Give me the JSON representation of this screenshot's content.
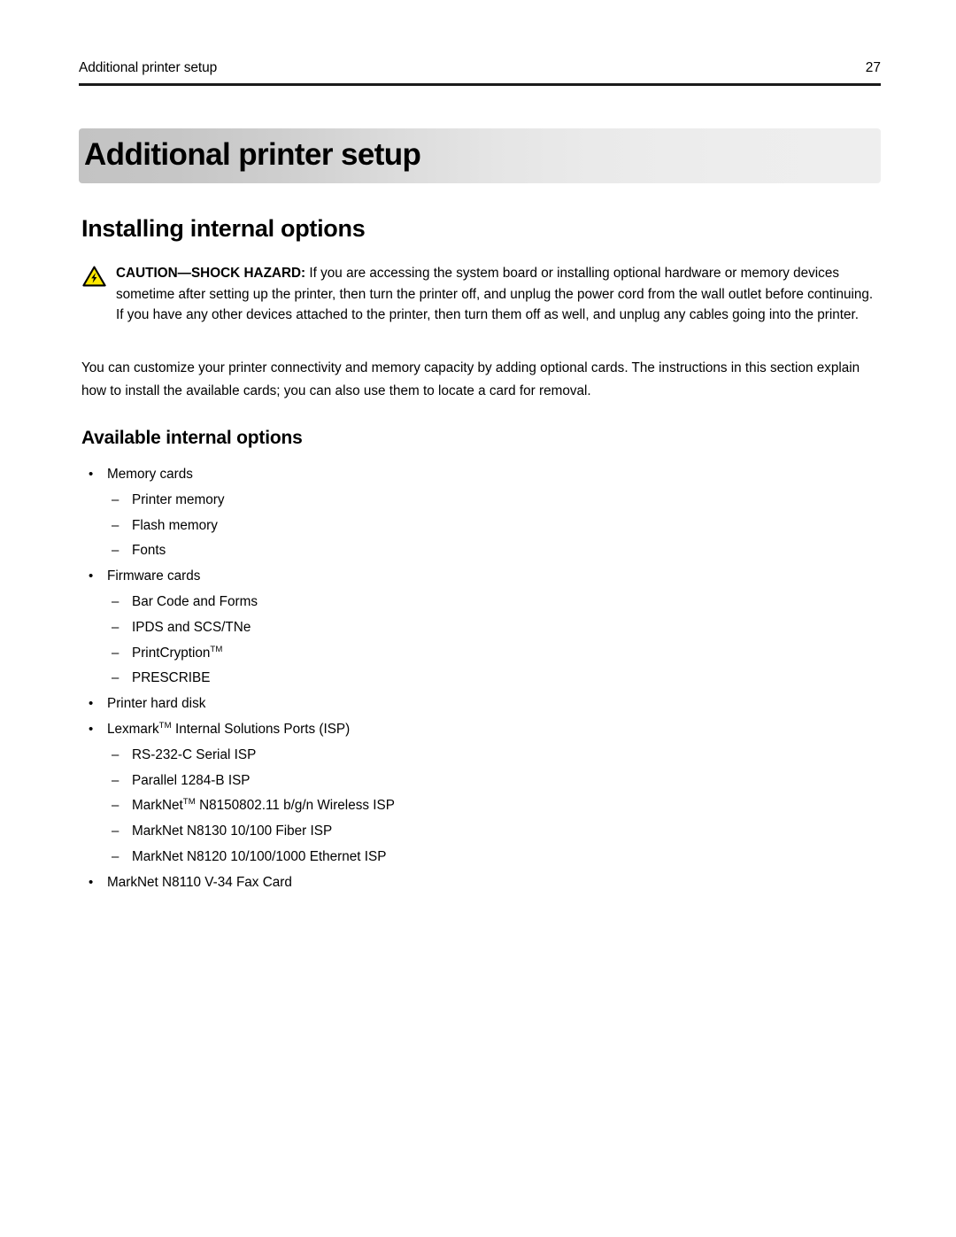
{
  "header": {
    "title": "Additional printer setup",
    "page_number": "27"
  },
  "chapter": {
    "title": "Additional printer setup"
  },
  "sections": {
    "h1": "Installing internal options",
    "h2": "Available internal options"
  },
  "caution": {
    "icon": "shock-hazard-warning-icon",
    "label": "CAUTION—SHOCK HAZARD:",
    "text": " If you are accessing the system board or installing optional hardware or memory devices sometime after setting up the printer, then turn the printer off, and unplug the power cord from the wall outlet before continuing. If you have any other devices attached to the printer, then turn them off as well, and unplug any cables going into the printer.",
    "icon_colors": {
      "fill": "#ffe800",
      "stroke": "#000000"
    }
  },
  "body_paragraph": "You can customize your printer connectivity and memory capacity by adding optional cards. The instructions in this section explain how to install the available cards; you can also use them to locate a card for removal.",
  "list": {
    "bullet_glyph": "•",
    "dash_glyph": "–",
    "items": [
      {
        "level": 1,
        "text": "Memory cards"
      },
      {
        "level": 2,
        "text": "Printer memory"
      },
      {
        "level": 2,
        "text": "Flash memory"
      },
      {
        "level": 2,
        "text": "Fonts"
      },
      {
        "level": 1,
        "text": "Firmware cards"
      },
      {
        "level": 2,
        "text": "Bar Code and Forms"
      },
      {
        "level": 2,
        "text": "IPDS and SCS/TNe"
      },
      {
        "level": 2,
        "text": "PrintCryption",
        "sup": "TM"
      },
      {
        "level": 2,
        "text": "PRESCRIBE"
      },
      {
        "level": 1,
        "text": "Printer hard disk"
      },
      {
        "level": 1,
        "text": "Lexmark",
        "sup": "TM",
        "text_after": " Internal Solutions Ports (ISP)"
      },
      {
        "level": 2,
        "text": "RS-232-C Serial ISP"
      },
      {
        "level": 2,
        "text": "Parallel 1284-B ISP"
      },
      {
        "level": 2,
        "text": "MarkNet",
        "sup": "TM",
        "text_after": " N8150802.11 b/g/n Wireless ISP"
      },
      {
        "level": 2,
        "text": "MarkNet N8130 10/100 Fiber ISP"
      },
      {
        "level": 2,
        "text": "MarkNet N8120 10/100/1000 Ethernet ISP"
      },
      {
        "level": 1,
        "text": "MarkNet N8110 V-34 Fax Card"
      }
    ]
  }
}
